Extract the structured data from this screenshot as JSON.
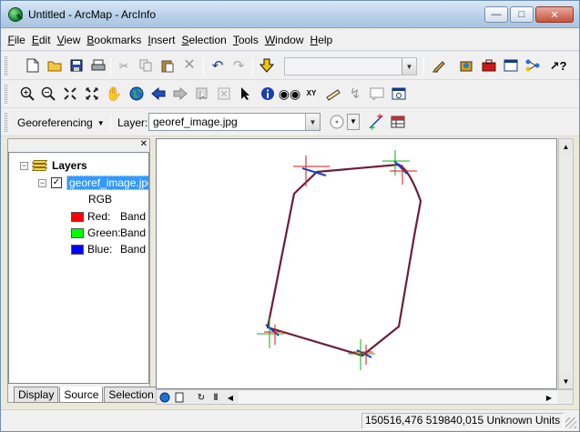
{
  "window": {
    "title": "Untitled - ArcMap - ArcInfo"
  },
  "menu": [
    "File",
    "Edit",
    "View",
    "Bookmarks",
    "Insert",
    "Selection",
    "Tools",
    "Window",
    "Help"
  ],
  "georef_toolbar": {
    "menu_label": "Georeferencing",
    "layer_label": "Layer:",
    "layer_value": "georef_image.jpg"
  },
  "toc": {
    "root_label": "Layers",
    "layer_name": "georef_image.jpg",
    "renderer_label": "RGB",
    "bands": [
      {
        "label": "Red:",
        "value": "Band",
        "color": "#ff0000"
      },
      {
        "label": "Green:",
        "value": "Band",
        "color": "#00ff00"
      },
      {
        "label": "Blue:",
        "value": "Band",
        "color": "#0000ff"
      }
    ],
    "tabs": [
      "Display",
      "Source",
      "Selection"
    ],
    "active_tab": "Source"
  },
  "status": {
    "coordinates": "150516,476  519840,015 Unknown Units"
  },
  "colors": {
    "outline": "#6a1f3a",
    "link_red": "#e01010",
    "link_green": "#10b010",
    "link_blue": "#1040e0"
  }
}
